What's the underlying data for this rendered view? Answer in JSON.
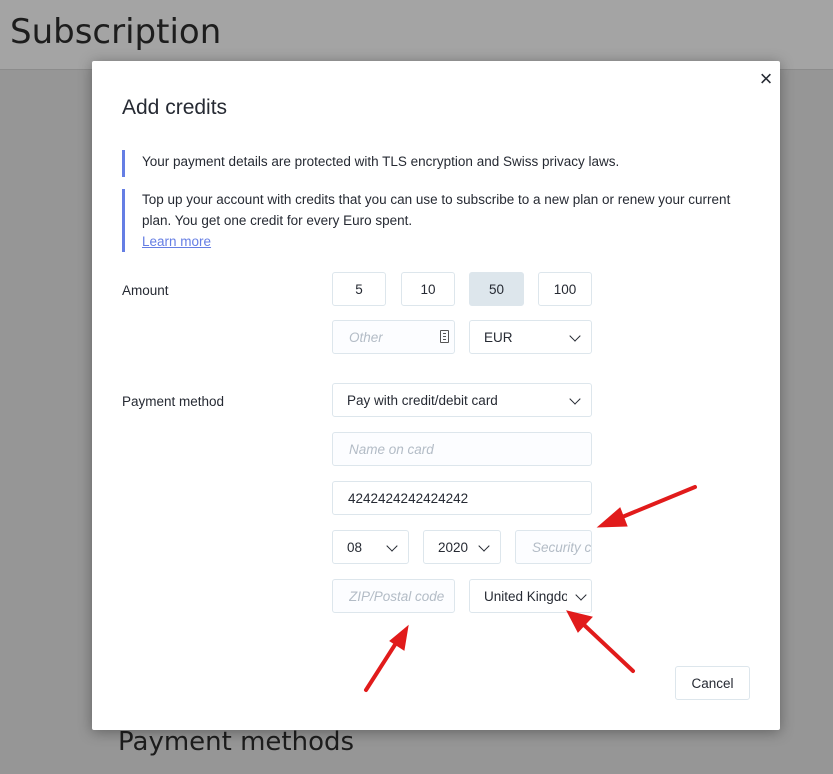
{
  "page": {
    "title": "Subscription",
    "section_title": "Payment methods"
  },
  "modal": {
    "title": "Add credits",
    "close_symbol": "×",
    "notice_security": "Your payment details are protected with TLS encryption and Swiss privacy laws.",
    "notice_credits": "Top up your account with credits that you can use to subscribe to a new plan or renew your current plan. You get one credit for every Euro spent.",
    "learn_more": "Learn more",
    "cancel_label": "Cancel"
  },
  "amount": {
    "label": "Amount",
    "options": [
      "5",
      "10",
      "50",
      "100"
    ],
    "selected": "50",
    "other_placeholder": "Other",
    "currency": "EUR"
  },
  "payment": {
    "label": "Payment method",
    "method": "Pay with credit/debit card",
    "name_placeholder": "Name on card",
    "card_number": "4242424242424242",
    "exp_month": "08",
    "exp_year": "2020",
    "security_placeholder": "Security code",
    "zip_placeholder": "ZIP/Postal code",
    "country": "United Kingdom"
  },
  "colors": {
    "accent": "#657ee4",
    "annotation_arrow": "#e11b1b",
    "overlay": "#969696"
  },
  "icons": {
    "close": "close-icon",
    "chevron": "chevron-down-icon",
    "stepper": "stepper-icon"
  }
}
